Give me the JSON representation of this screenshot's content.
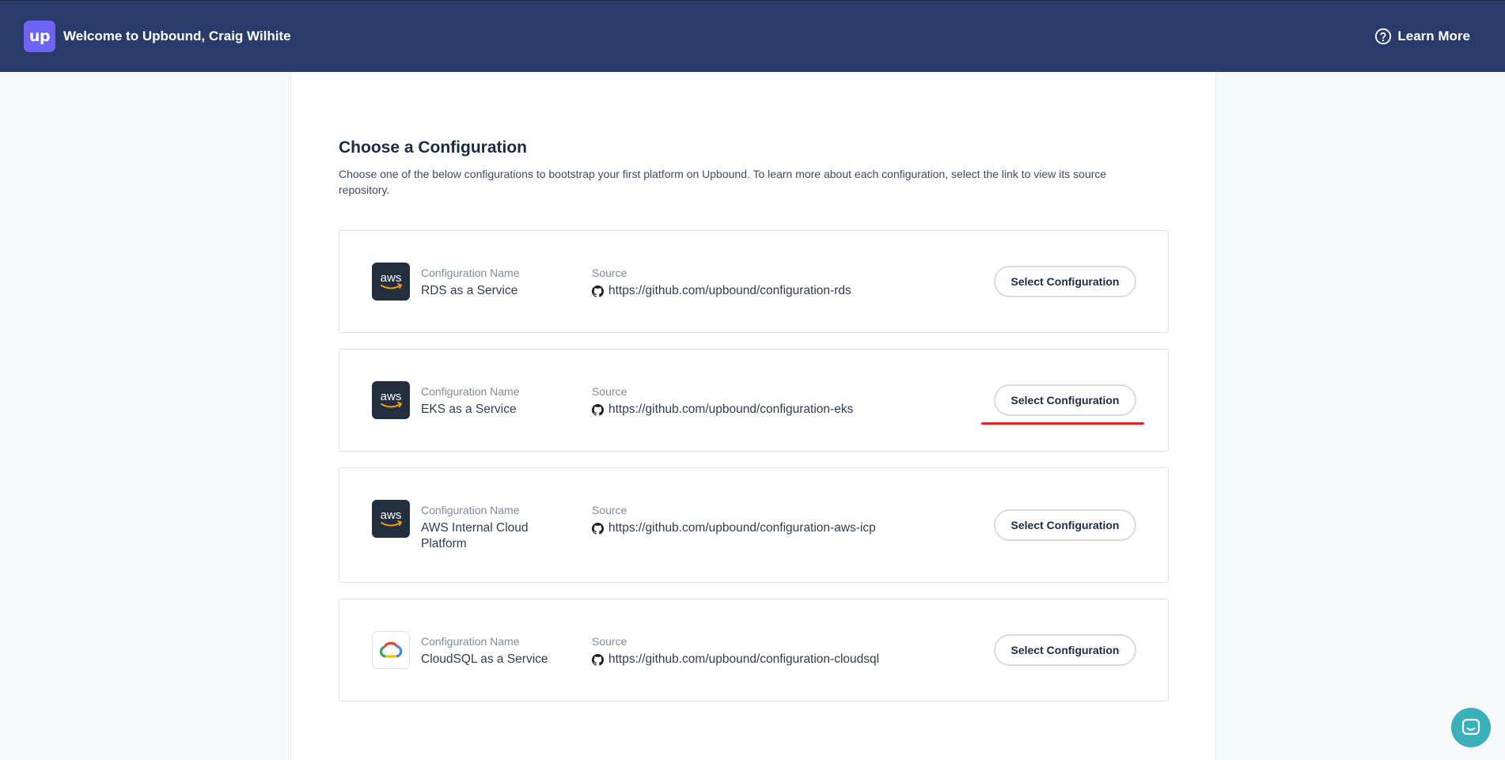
{
  "header": {
    "logo_text": "up",
    "welcome": "Welcome to Upbound, Craig Wilhite",
    "learn_more": "Learn More"
  },
  "page": {
    "title": "Choose a Configuration",
    "description": "Choose one of the below configurations to bootstrap your first platform on Upbound. To learn more about each configuration, select the link to view its source repository."
  },
  "labels": {
    "name": "Configuration Name",
    "source": "Source",
    "select": "Select Configuration"
  },
  "configurations": [
    {
      "provider": "aws",
      "provider_icon": "aws-logo-icon",
      "name": "RDS as a Service",
      "source": "https://github.com/upbound/configuration-rds"
    },
    {
      "provider": "aws",
      "provider_icon": "aws-logo-icon",
      "name": "EKS as a Service",
      "source": "https://github.com/upbound/configuration-eks"
    },
    {
      "provider": "aws",
      "provider_icon": "aws-logo-icon",
      "name": "AWS Internal Cloud Platform",
      "source": "https://github.com/upbound/configuration-aws-icp"
    },
    {
      "provider": "gcp",
      "provider_icon": "google-cloud-logo-icon",
      "name": "CloudSQL as a Service",
      "source": "https://github.com/upbound/configuration-cloudsql"
    }
  ],
  "colors": {
    "header_bg": "#283b6b",
    "logo_bg": "#6d63f5",
    "highlight": "#e02424",
    "chat_bg": "#3ab0bb"
  }
}
